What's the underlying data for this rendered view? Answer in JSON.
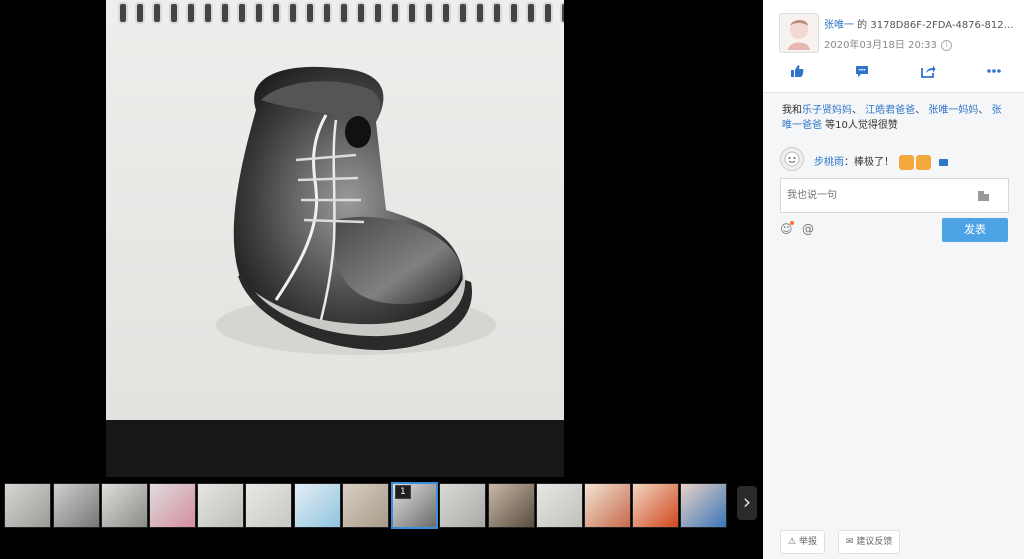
{
  "viewer": {
    "thumbnail_active_number": "1",
    "next_icon": "chevron-right-icon"
  },
  "post": {
    "author": "张唯一",
    "author_suffix": " 的 ",
    "album_id": "3178D86F-2FDA-4876-812…",
    "date": "2020年03月18日 20:33",
    "actions": [
      "thumbs-up-icon",
      "comment-icon",
      "share-icon",
      "more-icon"
    ]
  },
  "likes": {
    "prefix": "我和",
    "names": [
      "乐子贤妈妈",
      "江皓君爸爸",
      "张唯一妈妈",
      "张唯一爸爸"
    ],
    "suffix": " 等10人觉得很赞"
  },
  "comment": {
    "name": "步桃雨",
    "text": "：棒极了！"
  },
  "reply": {
    "placeholder": "我也说一句",
    "post_label": "发表"
  },
  "footer": {
    "report": "举报",
    "feedback": "建议反馈"
  },
  "colors": {
    "link": "#2f75c9",
    "button": "#4ca4e7"
  }
}
